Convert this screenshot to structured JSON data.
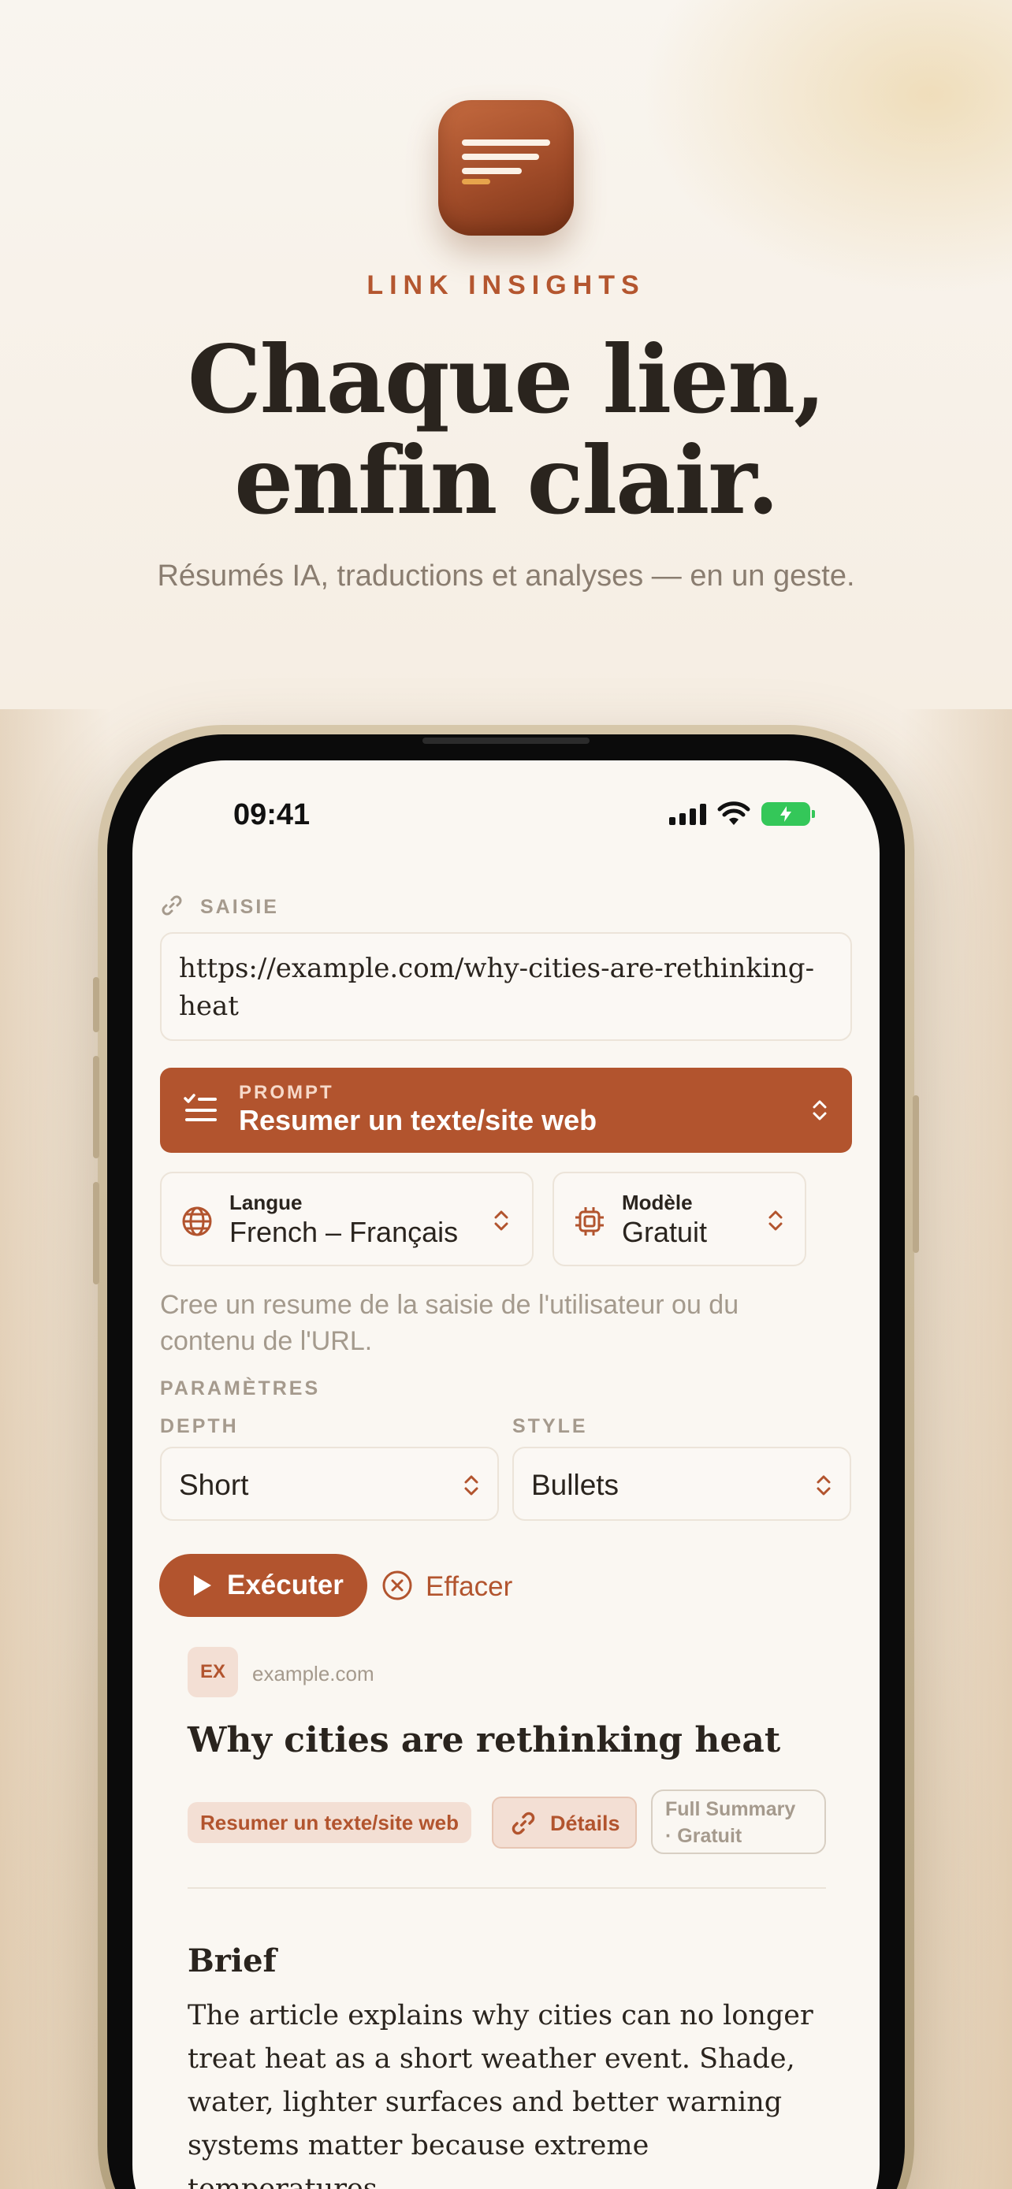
{
  "hero": {
    "brand": "LINK INSIGHTS",
    "headline_line1": "Chaque lien,",
    "headline_line2": "enfin clair.",
    "subtitle": "Résumés IA, traductions et analyses — en un geste."
  },
  "status_bar": {
    "time": "09:41",
    "icons": [
      "signal-icon",
      "wifi-icon",
      "battery-charging-icon"
    ]
  },
  "input": {
    "section_label": "SAISIE",
    "url_value": "https://example.com/why-cities-are-rethinking-heat"
  },
  "prompt": {
    "kicker": "PROMPT",
    "value": "Resumer un texte/site web"
  },
  "language": {
    "label": "Langue",
    "value": "French – Français"
  },
  "model": {
    "label": "Modèle",
    "value": "Gratuit"
  },
  "prompt_description": "Cree un resume de la saisie de l'utilisateur ou du contenu de l'URL.",
  "parameters": {
    "section_label": "PARAMÈTRES",
    "depth": {
      "label": "DEPTH",
      "value": "Short"
    },
    "style": {
      "label": "STYLE",
      "value": "Bullets"
    }
  },
  "actions": {
    "run_label": "Exécuter",
    "clear_label": "Effacer"
  },
  "result": {
    "favicon_text": "EX",
    "domain": "example.com",
    "title": "Why cities are rethinking heat",
    "tags": {
      "prompt": "Resumer un texte/site web",
      "details": "Détails",
      "mode_line1": "Full Summary",
      "mode_line2": "· Gratuit"
    },
    "brief_heading": "Brief",
    "brief_text": "The article explains why cities can no longer treat heat as a short weather event. Shade, water, lighter surfaces and better warning systems matter because extreme temperatures"
  },
  "colors": {
    "accent": "#b2542e",
    "background": "#faf7f2",
    "text": "#2a241e",
    "muted": "#a59a8d"
  }
}
